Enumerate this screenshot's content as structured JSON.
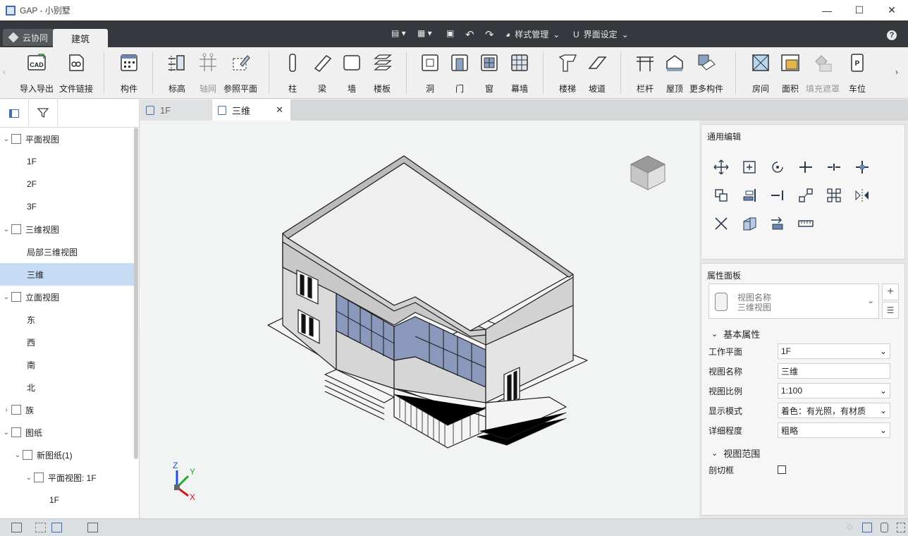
{
  "app": {
    "title": "GAP - 小别墅"
  },
  "menu": {
    "tab_cloud": "云协同",
    "tab_arch": "建筑",
    "style_manage": "样式管理",
    "ui_settings": "界面设定"
  },
  "ribbon": {
    "import_export": "导入导出",
    "file_link": "文件链接",
    "component": "构件",
    "level": "标高",
    "grid": "轴网",
    "ref_plane": "参照平面",
    "column": "柱",
    "beam": "梁",
    "wall": "墙",
    "slab": "楼板",
    "opening": "洞",
    "door": "门",
    "window": "窗",
    "curtain_wall": "幕墙",
    "stair": "楼梯",
    "ramp": "坡道",
    "railing": "栏杆",
    "roof": "屋顶",
    "more": "更多构件",
    "room": "房间",
    "area": "面积",
    "fill_mask": "填充遮罩",
    "parking": "车位"
  },
  "tree": [
    {
      "label": "平面视图",
      "level": 0,
      "expander": "v",
      "icon": true
    },
    {
      "label": "1F",
      "level": 1
    },
    {
      "label": "2F",
      "level": 1
    },
    {
      "label": "3F",
      "level": 1
    },
    {
      "label": "三维视图",
      "level": 0,
      "expander": "v",
      "icon": true
    },
    {
      "label": "局部三维视图",
      "level": 1
    },
    {
      "label": "三维",
      "level": 1,
      "selected": true
    },
    {
      "label": "立面视图",
      "level": 0,
      "expander": "v",
      "icon": true
    },
    {
      "label": "东",
      "level": 1
    },
    {
      "label": "西",
      "level": 1
    },
    {
      "label": "南",
      "level": 1
    },
    {
      "label": "北",
      "level": 1
    },
    {
      "label": "族",
      "level": 0,
      "expander": ">",
      "icon": true
    },
    {
      "label": "图纸",
      "level": 0,
      "expander": "v",
      "icon": true
    },
    {
      "label": "新图纸(1)",
      "level": 1,
      "expander": "v",
      "icon": true
    },
    {
      "label": "平面视图: 1F",
      "level": 2,
      "expander": "v",
      "icon": true
    },
    {
      "label": "1F",
      "level": 3
    }
  ],
  "doc_tabs": {
    "tab1": "1F",
    "tab2": "三维"
  },
  "axes": {
    "z": "Z",
    "y": "Y",
    "x": "X"
  },
  "right": {
    "general_edit": "通用编辑",
    "props_panel": "属性面板",
    "type_line1": "视图名称",
    "type_line2": "三维视图",
    "basic_props": "基本属性",
    "work_plane_label": "工作平面",
    "work_plane_value": "1F",
    "view_name_label": "视图名称",
    "view_name_value": "三维",
    "view_scale_label": "视图比例",
    "view_scale_value": "1:100",
    "display_mode_label": "显示模式",
    "display_mode_value": "着色：有光照，有材质",
    "detail_label": "详细程度",
    "detail_value": "粗略",
    "view_range": "视图范围",
    "section_box_label": "剖切框"
  }
}
